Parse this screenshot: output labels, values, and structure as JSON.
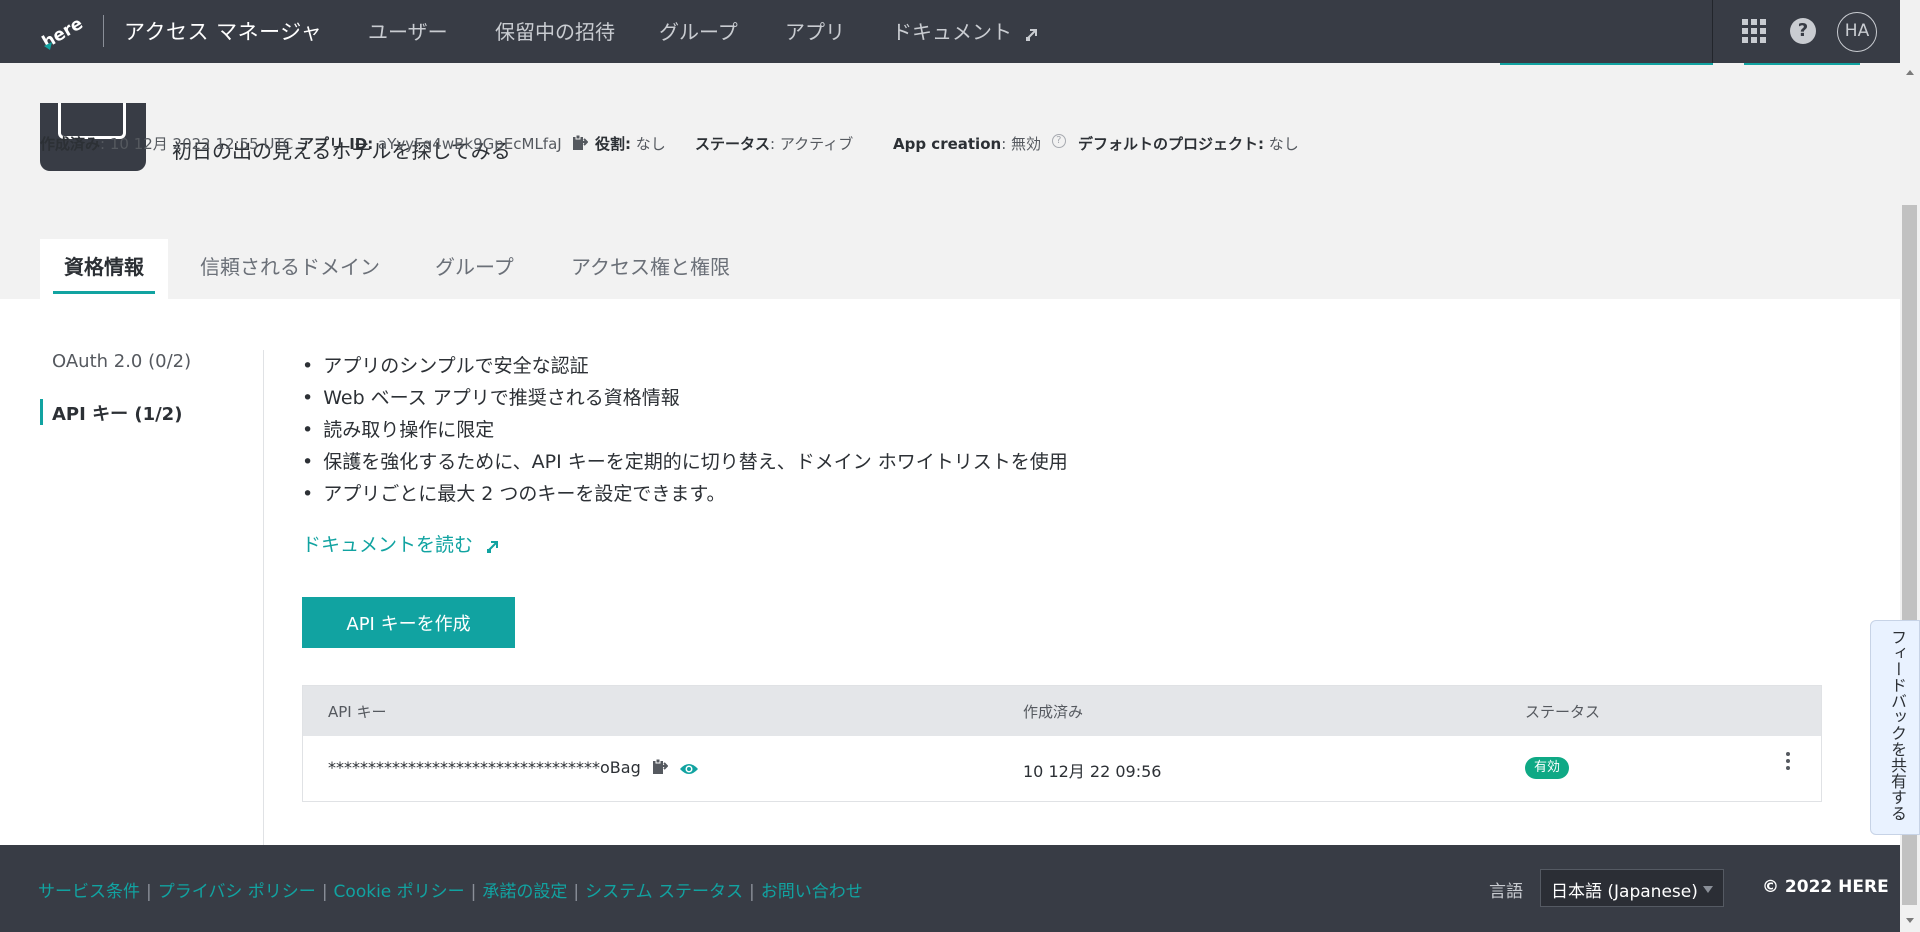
{
  "nav": {
    "logo_text": "here",
    "brand": "アクセス マネージャ",
    "items": [
      {
        "label": "ユーザー"
      },
      {
        "label": "保留中の招待"
      },
      {
        "label": "グループ"
      },
      {
        "label": "アプリ"
      },
      {
        "label": "ドキュメント"
      }
    ],
    "avatar_initials": "HA",
    "help_label": "?"
  },
  "app": {
    "tagline": "初日の出の見えるホテルを探してみる",
    "meta": {
      "created_label": "作成済み",
      "created_value": ": 10 12月 2022 12:55 UTC",
      "app_id_label": "アプリ ID:",
      "app_id_value": "aYvyFq4wBk9GpEcMLfaJ",
      "role_label": "役割:",
      "role_value": "なし",
      "status_label": "ステータス",
      "status_value": ": アクティブ",
      "app_creation_label": "App creation",
      "app_creation_value": ": 無効",
      "default_project_label": "デフォルトのプロジェクト:",
      "default_project_value": "なし"
    }
  },
  "tabs": [
    {
      "label": "資格情報",
      "active": true
    },
    {
      "label": "信頼されるドメイン",
      "active": false
    },
    {
      "label": "グループ",
      "active": false
    },
    {
      "label": "アクセス権と権限",
      "active": false
    }
  ],
  "subnav": [
    {
      "label": "OAuth 2.0 (0/2)",
      "active": false
    },
    {
      "label": "API キー (1/2)",
      "active": true
    }
  ],
  "content": {
    "bullets": [
      "アプリのシンプルで安全な認証",
      "Web ベース アプリで推奨される資格情報",
      "読み取り操作に限定",
      "保護を強化するために、API キーを定期的に切り替え、ドメイン ホワイトリストを使用",
      "アプリごとに最大 2 つのキーを設定できます。"
    ],
    "doc_link": "ドキュメントを読む",
    "create_button": "API キーを作成"
  },
  "table": {
    "headers": [
      "API キー",
      "作成済み",
      "ステータス"
    ],
    "rows": [
      {
        "key": "**********************************oBag",
        "created": "10 12月 22 09:56",
        "status": "有効"
      }
    ]
  },
  "feedback": "フィードバックを共有する",
  "footer": {
    "links": [
      "サービス条件",
      "プライバシ ポリシー",
      "Cookie ポリシー",
      "承諾の設定",
      "システム ステータス",
      "お問い合わせ"
    ],
    "lang_label": "言語",
    "lang_value": "日本語 (Japanese)",
    "copyright": "© 2022 HERE"
  },
  "colors": {
    "accent": "#11a3a1",
    "nav_bg": "#383c45",
    "status_active": "#0fa985",
    "header_bg": "#f2f2f2"
  }
}
